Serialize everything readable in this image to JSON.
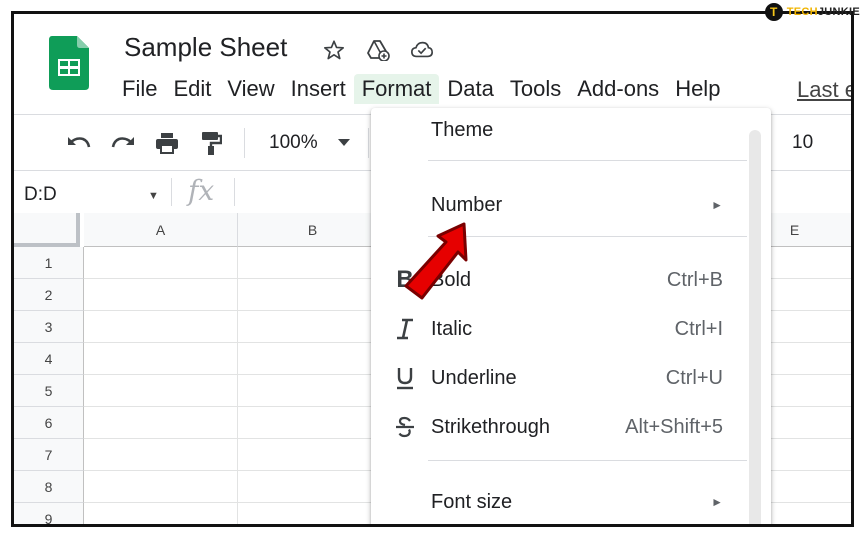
{
  "watermark": {
    "part1": "TECH",
    "part2": "JUNKIE",
    "logo_letter": "T"
  },
  "header": {
    "title": "Sample Sheet",
    "icons": [
      "star-icon",
      "move-to-drive-icon",
      "cloud-saved-icon"
    ],
    "last_edit": "Last e"
  },
  "menubar": [
    "File",
    "Edit",
    "View",
    "Insert",
    "Format",
    "Data",
    "Tools",
    "Add-ons",
    "Help"
  ],
  "menubar_active": "Format",
  "toolbar": {
    "zoom": "100%",
    "font_size": "10"
  },
  "formula_bar": {
    "name_box": "D:D",
    "fx": "fx"
  },
  "grid": {
    "columns": [
      "A",
      "B",
      "E"
    ],
    "rows": [
      "1",
      "2",
      "3",
      "4",
      "5",
      "6",
      "7",
      "8",
      "9"
    ]
  },
  "format_menu": {
    "theme": "Theme",
    "number": "Number",
    "bold": {
      "label": "Bold",
      "shortcut": "Ctrl+B"
    },
    "italic": {
      "label": "Italic",
      "shortcut": "Ctrl+I"
    },
    "underline": {
      "label": "Underline",
      "shortcut": "Ctrl+U"
    },
    "strikethrough": {
      "label": "Strikethrough",
      "shortcut": "Alt+Shift+5"
    },
    "font_size": "Font size",
    "submenu_arrow": "►"
  },
  "colors": {
    "sheets_green": "#0f9d58",
    "menu_active_bg": "#e6f4ea",
    "pointer_arrow": "#e60000"
  }
}
